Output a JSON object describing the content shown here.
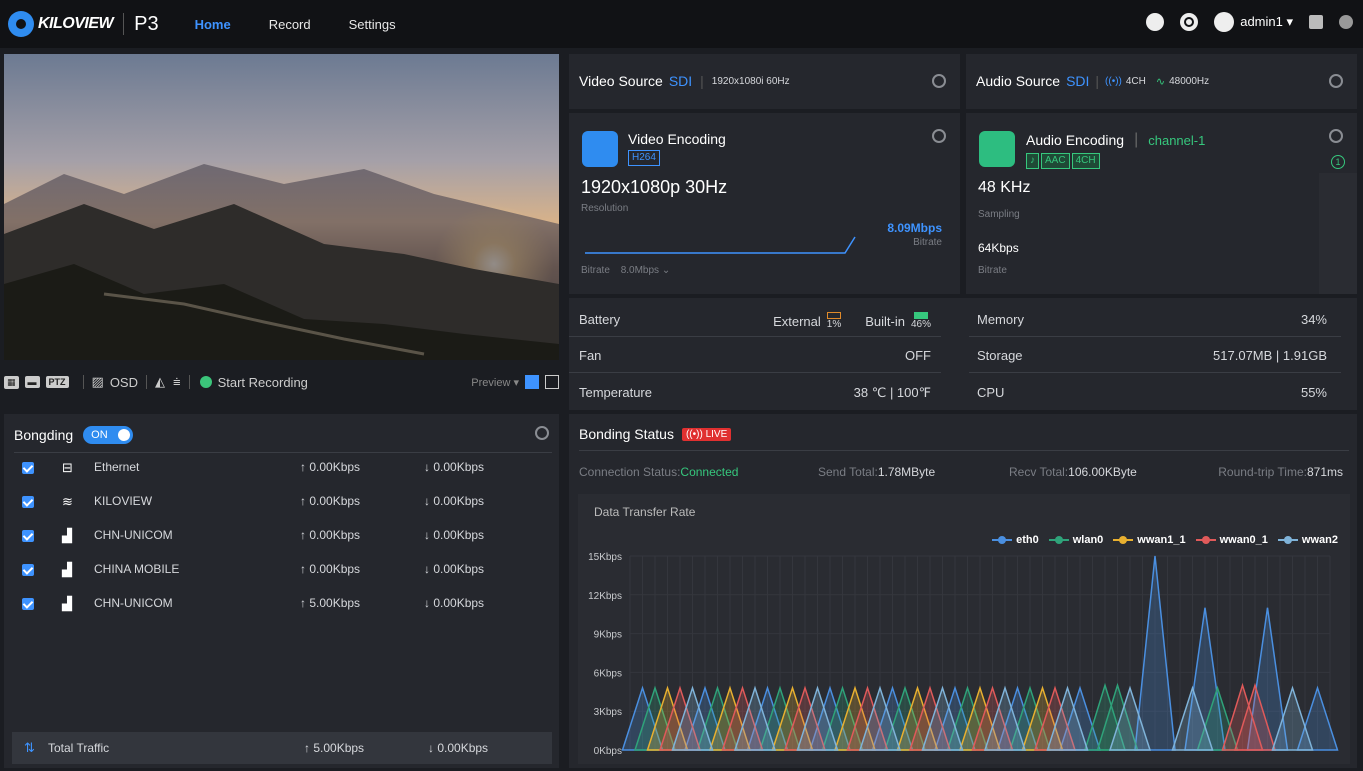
{
  "app": {
    "brand": "KILOVIEW",
    "product": "P3"
  },
  "nav": [
    {
      "label": "Home",
      "active": true
    },
    {
      "label": "Record"
    },
    {
      "label": "Settings"
    }
  ],
  "user": {
    "name": "admin1 ▾"
  },
  "preview": {
    "ctrl": {
      "osd": "OSD",
      "record": "Start Recording",
      "preview": "Preview ▾"
    }
  },
  "video_source": {
    "label": "Video Source",
    "type": "SDI",
    "format": "1920x1080i 60Hz"
  },
  "audio_source": {
    "label": "Audio Source",
    "type": "SDI",
    "channels": "4CH",
    "rate": "48000Hz"
  },
  "video_encoding": {
    "title": "Video Encoding",
    "codec": "H264",
    "resolution": "1920x1080p 30Hz",
    "resolution_label": "Resolution",
    "bitrate_value": "8.09Mbps",
    "bitrate_label": "Bitrate",
    "bitrate_setting_label": "Bitrate",
    "bitrate_setting": "8.0Mbps"
  },
  "audio_encoding": {
    "title": "Audio Encoding",
    "channel": "channel-1",
    "codec": "AAC",
    "channels": "4CH",
    "sampling": "48 KHz",
    "sampling_label": "Sampling",
    "bitrate": "64Kbps",
    "bitrate_label": "Bitrate",
    "index": "1"
  },
  "stats": {
    "battery_label": "Battery",
    "external_label": "External",
    "external_pct": "1%",
    "builtin_label": "Built-in",
    "builtin_pct": "46%",
    "fan_label": "Fan",
    "fan_value": "OFF",
    "temp_label": "Temperature",
    "temp_value": "38 ℃ | 100℉",
    "memory_label": "Memory",
    "memory_value": "34%",
    "storage_label": "Storage",
    "storage_value": "517.07MB | 1.91GB",
    "cpu_label": "CPU",
    "cpu_value": "55%"
  },
  "bonding": {
    "title": "Bongding",
    "toggle": "ON",
    "items": [
      {
        "name": "Ethernet",
        "icon": "ethernet-icon",
        "up": "↑ 0.00Kbps",
        "down": "↓ 0.00Kbps"
      },
      {
        "name": "KILOVIEW",
        "icon": "wifi-icon",
        "up": "↑ 0.00Kbps",
        "down": "↓ 0.00Kbps"
      },
      {
        "name": "CHN-UNICOM",
        "icon": "cellular-5g-icon",
        "up": "↑ 0.00Kbps",
        "down": "↓ 0.00Kbps"
      },
      {
        "name": "CHINA MOBILE",
        "icon": "cellular-5g-icon",
        "up": "↑ 0.00Kbps",
        "down": "↓ 0.00Kbps"
      },
      {
        "name": "CHN-UNICOM",
        "icon": "cellular-4g-icon",
        "up": "↑ 5.00Kbps",
        "down": "↓ 0.00Kbps"
      }
    ],
    "total_label": "Total Traffic",
    "total_up": "↑ 5.00Kbps",
    "total_down": "↓ 0.00Kbps"
  },
  "bonding_status": {
    "title": "Bonding Status",
    "live": "((•)) LIVE",
    "conn_label": "Connection Status:",
    "conn_value": "Connected",
    "send_label": "Send Total:",
    "send_value": "1.78MByte",
    "recv_label": "Recv Total:",
    "recv_value": "106.00KByte",
    "rtt_label": "Round-trip Time:",
    "rtt_value": "871ms"
  },
  "chart_data": {
    "type": "area",
    "title": "Data Transfer Rate",
    "y_ticks": [
      "15Kbps",
      "12Kbps",
      "9Kbps",
      "6Kbps",
      "3Kbps",
      "0Kbps"
    ],
    "ylim": [
      0,
      15
    ],
    "legend_position": "top-right",
    "series": [
      {
        "name": "eth0",
        "color": "#4a8fe0",
        "peaks": [
          {
            "x": 0,
            "v": 4.8
          },
          {
            "x": 5,
            "v": 4.8
          },
          {
            "x": 10,
            "v": 4.8
          },
          {
            "x": 15,
            "v": 4.8
          },
          {
            "x": 20,
            "v": 4.8
          },
          {
            "x": 25,
            "v": 4.8
          },
          {
            "x": 30,
            "v": 4.8
          },
          {
            "x": 35,
            "v": 4.8
          },
          {
            "x": 41,
            "v": 15
          },
          {
            "x": 45,
            "v": 11
          },
          {
            "x": 50,
            "v": 11
          },
          {
            "x": 54,
            "v": 4.8
          }
        ]
      },
      {
        "name": "wlan0",
        "color": "#2fa37a",
        "peaks": [
          {
            "x": 1,
            "v": 4.8
          },
          {
            "x": 6,
            "v": 4.8
          },
          {
            "x": 11,
            "v": 4.8
          },
          {
            "x": 16,
            "v": 4.8
          },
          {
            "x": 21,
            "v": 4.8
          },
          {
            "x": 26,
            "v": 4.8
          },
          {
            "x": 31,
            "v": 4.8
          },
          {
            "x": 37,
            "v": 5
          },
          {
            "x": 38,
            "v": 5
          },
          {
            "x": 46,
            "v": 4.8
          }
        ]
      },
      {
        "name": "wwan1_1",
        "color": "#e8b030",
        "peaks": [
          {
            "x": 2,
            "v": 4.8
          },
          {
            "x": 7,
            "v": 4.8
          },
          {
            "x": 12,
            "v": 4.8
          },
          {
            "x": 17,
            "v": 4.8
          },
          {
            "x": 22,
            "v": 4.8
          },
          {
            "x": 27,
            "v": 4.8
          },
          {
            "x": 32,
            "v": 4.8
          }
        ]
      },
      {
        "name": "wwan0_1",
        "color": "#e05a5a",
        "peaks": [
          {
            "x": 3,
            "v": 4.8
          },
          {
            "x": 8,
            "v": 4.8
          },
          {
            "x": 13,
            "v": 4.8
          },
          {
            "x": 18,
            "v": 4.8
          },
          {
            "x": 23,
            "v": 4.8
          },
          {
            "x": 28,
            "v": 4.8
          },
          {
            "x": 33,
            "v": 4.8
          },
          {
            "x": 48,
            "v": 5
          },
          {
            "x": 49,
            "v": 5
          }
        ]
      },
      {
        "name": "wwan2",
        "color": "#7fb3d9",
        "peaks": [
          {
            "x": 4,
            "v": 4.8
          },
          {
            "x": 9,
            "v": 4.8
          },
          {
            "x": 14,
            "v": 4.8
          },
          {
            "x": 19,
            "v": 4.8
          },
          {
            "x": 24,
            "v": 4.8
          },
          {
            "x": 29,
            "v": 4.8
          },
          {
            "x": 34,
            "v": 4.8
          },
          {
            "x": 39,
            "v": 4.8
          },
          {
            "x": 44,
            "v": 4.8
          },
          {
            "x": 52,
            "v": 4.8
          }
        ]
      }
    ]
  }
}
